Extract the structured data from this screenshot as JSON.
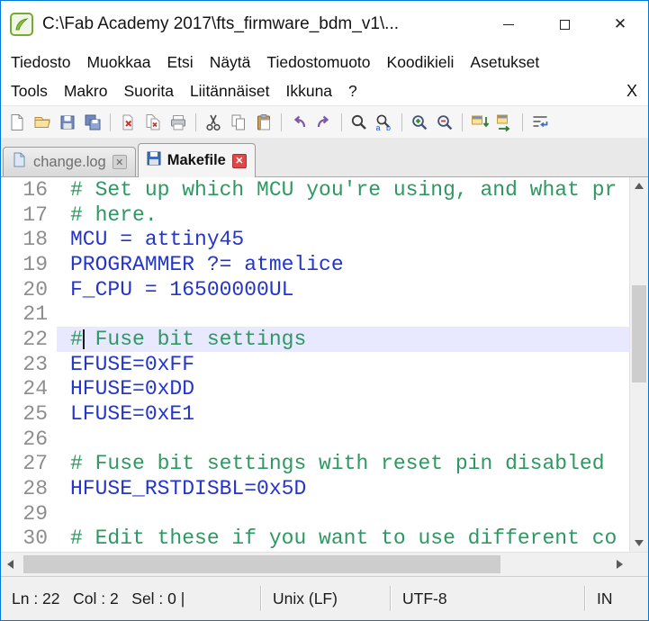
{
  "window": {
    "title": "C:\\Fab Academy 2017\\fts_firmware_bdm_v1\\...",
    "close_glyph": "✕"
  },
  "menu": {
    "row1": [
      "Tiedosto",
      "Muokkaa",
      "Etsi",
      "Näytä",
      "Tiedostomuoto",
      "Koodikieli",
      "Asetukset"
    ],
    "row2": [
      "Tools",
      "Makro",
      "Suorita",
      "Liitännäiset",
      "Ikkuna",
      "?"
    ],
    "close_doc": "X"
  },
  "toolbar": {
    "icons": [
      "new-file",
      "open-folder",
      "save",
      "save-all",
      "sep",
      "close-file",
      "close-all",
      "print",
      "sep",
      "cut",
      "copy",
      "paste",
      "sep",
      "undo",
      "redo",
      "sep",
      "find",
      "replace",
      "sep",
      "zoom-in",
      "zoom-out",
      "sep",
      "sync-vertical",
      "sync-horizontal",
      "sep",
      "word-wrap"
    ]
  },
  "tabs": [
    {
      "label": "change.log",
      "state": "inactive"
    },
    {
      "label": "Makefile",
      "state": "active"
    }
  ],
  "editor": {
    "lines": [
      {
        "num": "16",
        "type": "comment",
        "text": "# Set up which MCU you're using, and what pr"
      },
      {
        "num": "17",
        "type": "comment",
        "text": "# here."
      },
      {
        "num": "18",
        "type": "code",
        "text": "MCU = attiny45"
      },
      {
        "num": "19",
        "type": "code",
        "text": "PROGRAMMER ?= atmelice"
      },
      {
        "num": "20",
        "type": "code",
        "text": "F_CPU = 16500000UL"
      },
      {
        "num": "21",
        "type": "blank",
        "text": ""
      },
      {
        "num": "22",
        "type": "comment",
        "text": "# Fuse bit settings",
        "current": true
      },
      {
        "num": "23",
        "type": "code",
        "text": "EFUSE=0xFF"
      },
      {
        "num": "24",
        "type": "code",
        "text": "HFUSE=0xDD"
      },
      {
        "num": "25",
        "type": "code",
        "text": "LFUSE=0xE1"
      },
      {
        "num": "26",
        "type": "blank",
        "text": ""
      },
      {
        "num": "27",
        "type": "comment",
        "text": "# Fuse bit settings with reset pin disabled"
      },
      {
        "num": "28",
        "type": "code",
        "text": "HFUSE_RSTDISBL=0x5D"
      },
      {
        "num": "29",
        "type": "blank",
        "text": ""
      },
      {
        "num": "30",
        "type": "comment",
        "text": "# Edit these if you want to use different co"
      }
    ]
  },
  "status": {
    "position": "Ln : 22   Col : 2   Sel : 0 |",
    "eol": "Unix (LF)",
    "encoding": "UTF-8",
    "mode": "IN"
  },
  "colors": {
    "accent": "#0078D7",
    "comment": "#2E9862",
    "code": "#2335CB",
    "line_highlight": "#E8E8FF",
    "line_number": "#8D8D8D"
  }
}
